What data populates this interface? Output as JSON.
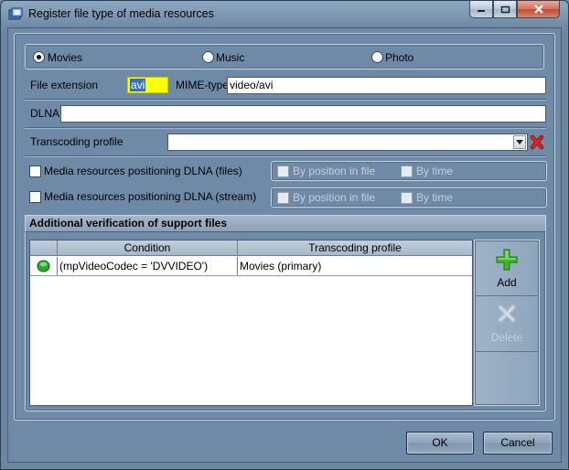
{
  "window": {
    "title": "Register file type of media resources",
    "icons": {
      "app": "media-register-icon",
      "minimize": "minimize-icon",
      "maximize": "maximize-icon",
      "close": "close-icon"
    }
  },
  "media_type": {
    "options": [
      {
        "label": "Movies",
        "selected": true
      },
      {
        "label": "Music",
        "selected": false
      },
      {
        "label": "Photo",
        "selected": false
      }
    ]
  },
  "fields": {
    "file_extension_label": "File extension",
    "file_extension_value": "avi",
    "mime_type_label": "MIME-type",
    "mime_type_value": "video/avi",
    "dlna_label": "DLNA",
    "dlna_value": "",
    "transcoding_profile_label": "Transcoding profile",
    "transcoding_profile_value": ""
  },
  "positioning": {
    "files_label": "Media resources positioning DLNA (files)",
    "stream_label": "Media resources positioning DLNA  (stream)",
    "by_position_label": "By position in file",
    "by_time_label": "By time"
  },
  "verification": {
    "title": "Additional verification of support files",
    "columns": [
      "Condition",
      "Transcoding profile"
    ],
    "rows": [
      {
        "condition": "(mpVideoCodec = 'DVVIDEO')",
        "profile": "Movies (primary)",
        "status_color": "#22b022"
      }
    ],
    "add_label": "Add",
    "delete_label": "Delete"
  },
  "footer": {
    "ok_label": "OK",
    "cancel_label": "Cancel"
  },
  "colors": {
    "background": "#6f8aa6",
    "extension_highlight": "#ffff00",
    "add_icon": "#3fb82a",
    "clear_icon": "#e0261a"
  }
}
